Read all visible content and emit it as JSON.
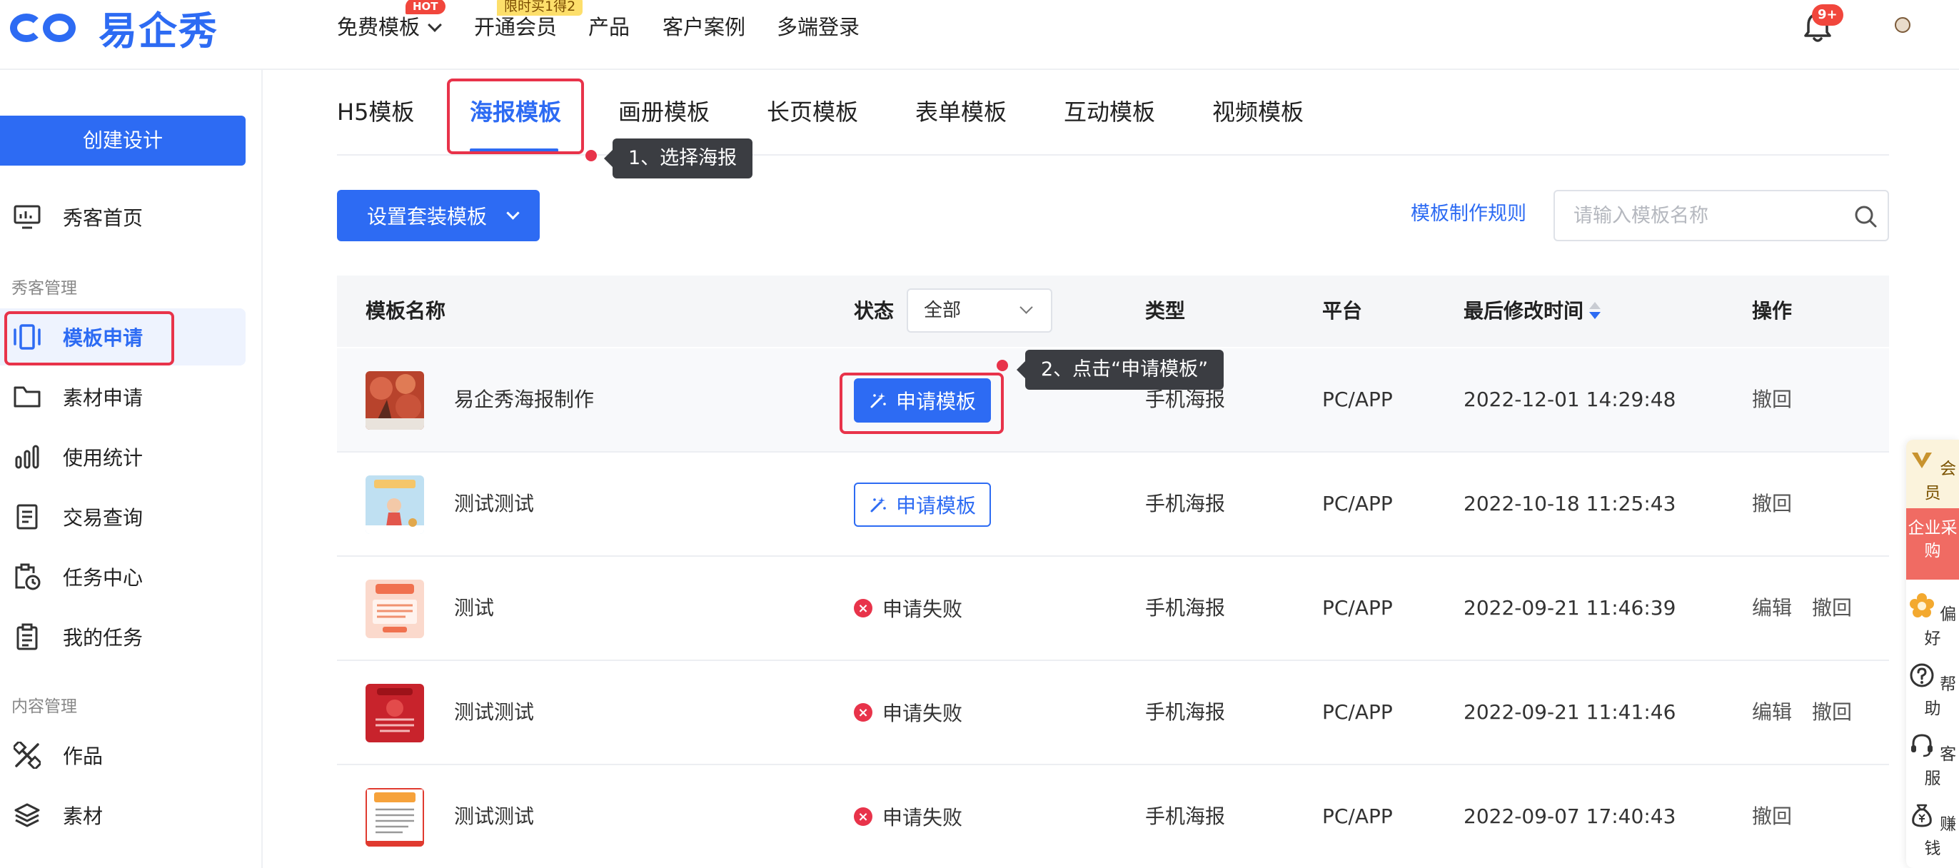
{
  "header": {
    "logo_text": "易企秀",
    "nav": {
      "free_templates": "免费模板",
      "hot_badge": "HOT",
      "membership": "开通会员",
      "promo_badge": "限时买1得2",
      "products": "产品",
      "cases": "客户案例",
      "multi_login": "多端登录"
    },
    "notification_count": "9+"
  },
  "sidebar": {
    "create_button": "创建设计",
    "home": "秀客首页",
    "group_creator": "秀客管理",
    "template_apply": "模板申请",
    "material_apply": "素材申请",
    "usage_stats": "使用统计",
    "transactions": "交易查询",
    "task_center": "任务中心",
    "my_tasks": "我的任务",
    "group_content": "内容管理",
    "works": "作品",
    "materials": "素材"
  },
  "tabs": [
    "H5模板",
    "海报模板",
    "画册模板",
    "长页模板",
    "表单模板",
    "互动模板",
    "视频模板"
  ],
  "annotations": {
    "step1": "1、选择海报",
    "step2": "2、点击“申请模板”"
  },
  "toolbar": {
    "suite_button": "设置套装模板",
    "rules_link": "模板制作规则",
    "search_placeholder": "请输入模板名称"
  },
  "table": {
    "headers": {
      "name": "模板名称",
      "status": "状态",
      "status_filter": "全部",
      "type": "类型",
      "platform": "平台",
      "modified": "最后修改时间",
      "actions": "操作"
    },
    "apply_label": "申请模板",
    "fail_label": "申请失败",
    "edit_label": "编辑",
    "revoke_label": "撤回",
    "rows": [
      {
        "name": "易企秀海报制作",
        "type": "手机海报",
        "platform": "PC/APP",
        "modified": "2022-12-01 14:29:48"
      },
      {
        "name": "测试测试",
        "type": "手机海报",
        "platform": "PC/APP",
        "modified": "2022-10-18 11:25:43"
      },
      {
        "name": "测试",
        "type": "手机海报",
        "platform": "PC/APP",
        "modified": "2022-09-21 11:46:39"
      },
      {
        "name": "测试测试",
        "type": "手机海报",
        "platform": "PC/APP",
        "modified": "2022-09-21 11:41:46"
      },
      {
        "name": "测试测试",
        "type": "手机海报",
        "platform": "PC/APP",
        "modified": "2022-09-07 17:40:43"
      }
    ]
  },
  "rail": {
    "member": "会员",
    "enterprise": "企业采购",
    "preference": "偏好",
    "help": "帮助",
    "service": "客服",
    "earn": "赚钱"
  },
  "colors": {
    "primary": "#2d6bf3",
    "highlight": "#e8334a",
    "tooltip": "#3b3d42"
  }
}
